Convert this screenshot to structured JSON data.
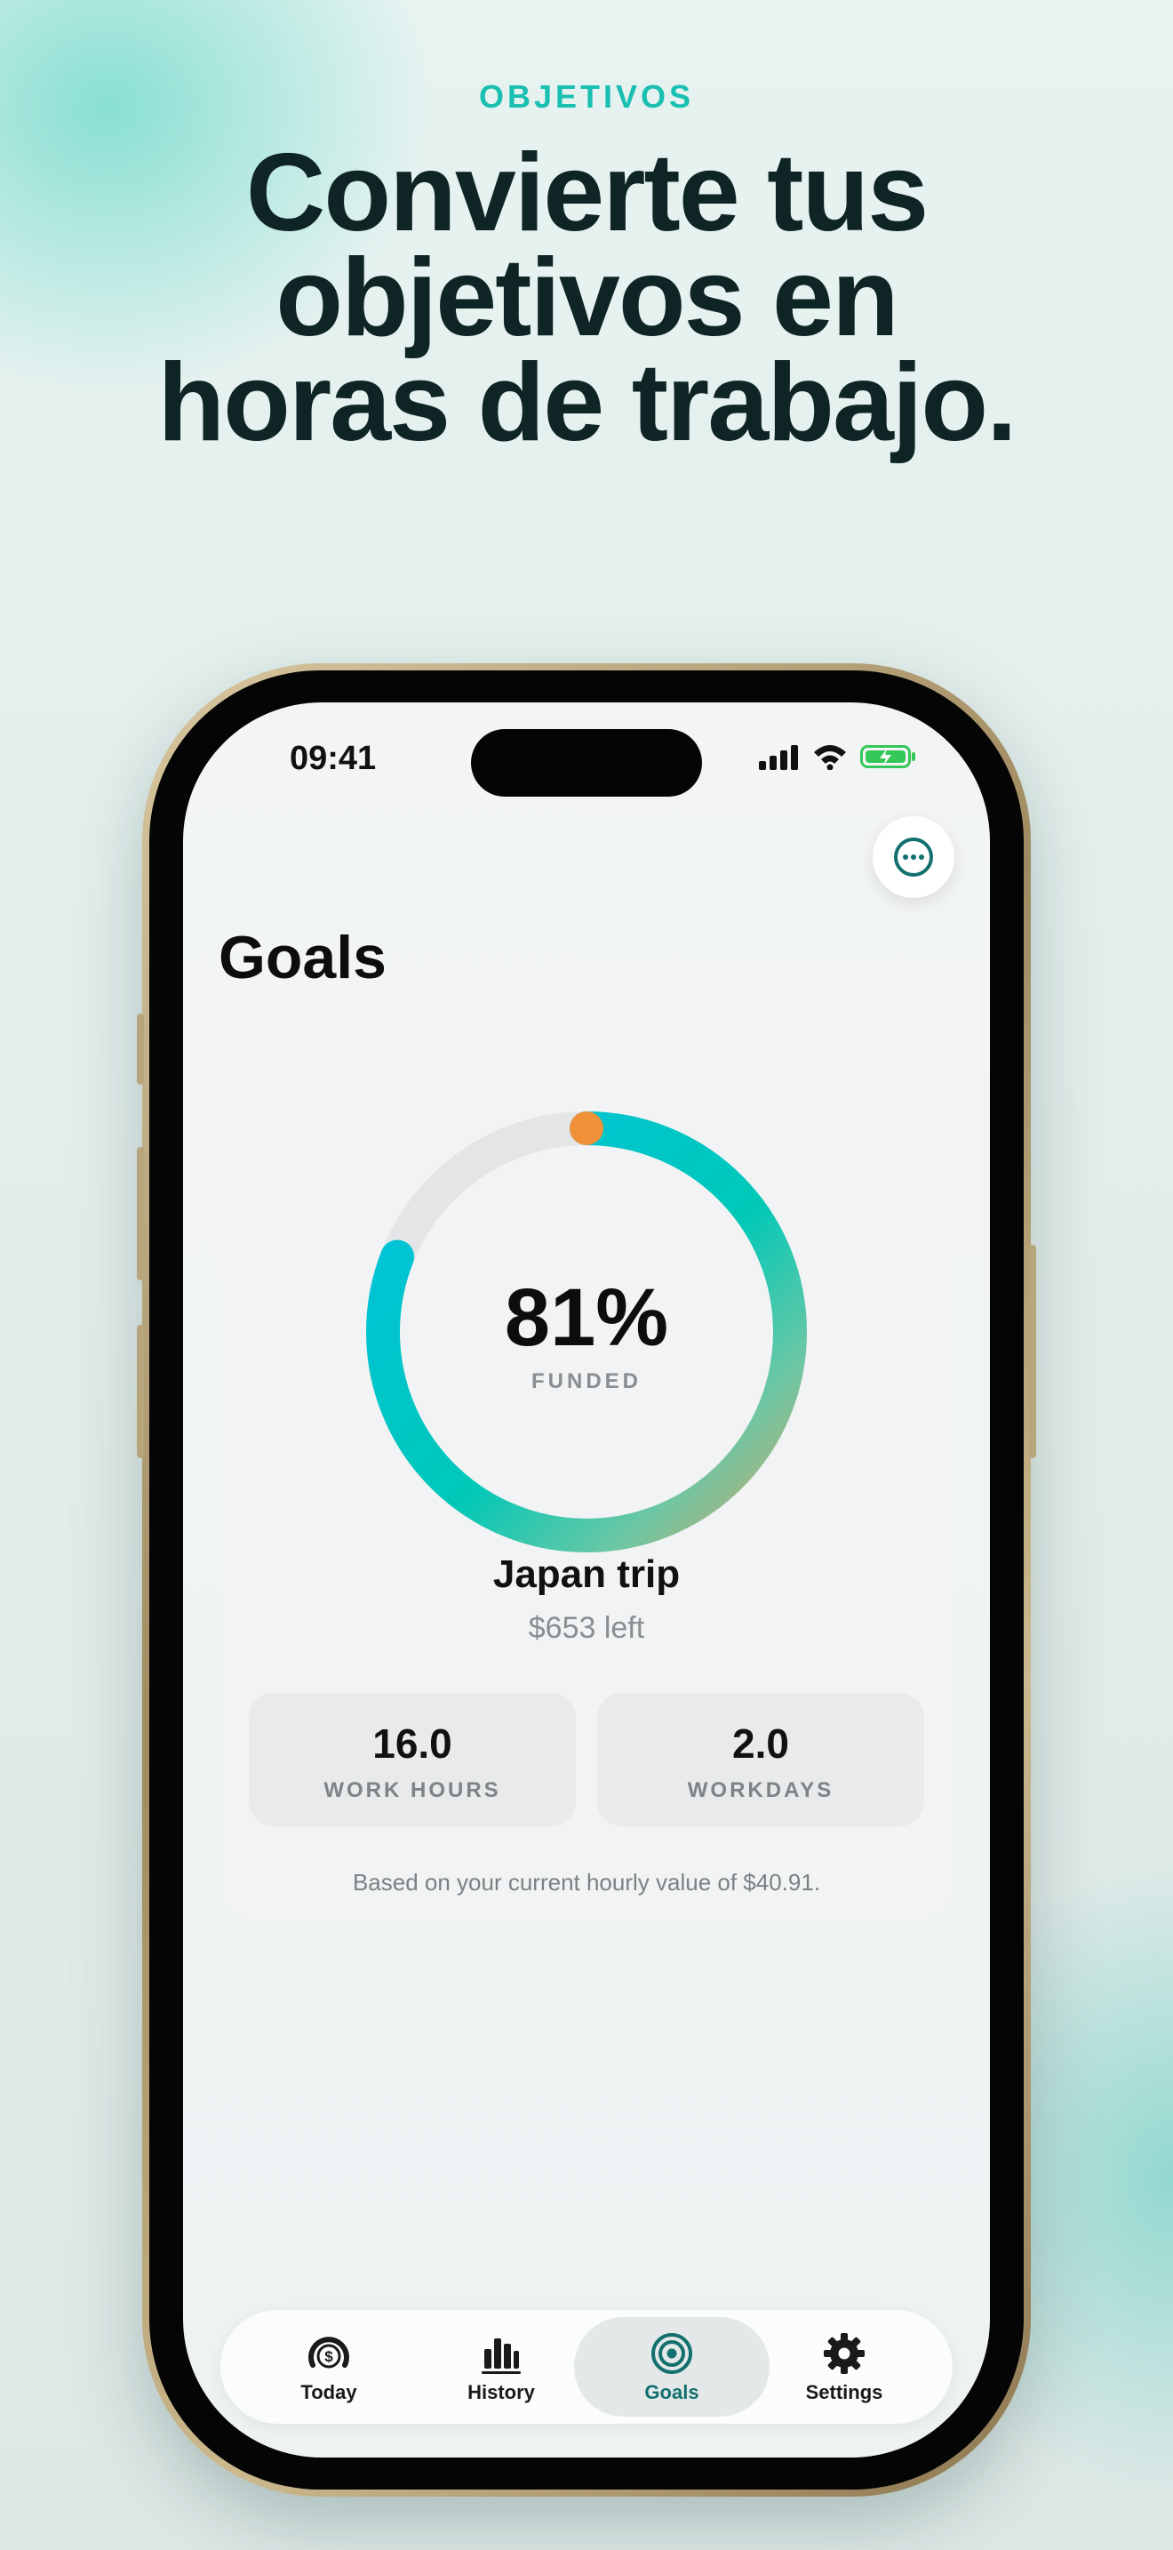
{
  "marketing": {
    "eyebrow": "OBJETIVOS",
    "headline": "Convierte tus objetivos en horas de trabajo."
  },
  "status_bar": {
    "time": "09:41"
  },
  "page": {
    "title": "Goals"
  },
  "goal": {
    "percent_text": "81%",
    "funded_label": "FUNDED",
    "funded_fraction": 0.81,
    "name": "Japan trip",
    "left_text": "$653 left",
    "stats": [
      {
        "value": "16.0",
        "label": "WORK HOURS"
      },
      {
        "value": "2.0",
        "label": "WORKDAYS"
      }
    ],
    "footnote": "Based on your current hourly value of $40.91."
  },
  "tabbar": {
    "tabs": [
      {
        "label": "Today",
        "icon": "dollar-gauge-icon",
        "active": false
      },
      {
        "label": "History",
        "icon": "bar-chart-icon",
        "active": false
      },
      {
        "label": "Goals",
        "icon": "target-icon",
        "active": true
      },
      {
        "label": "Settings",
        "icon": "gear-icon",
        "active": false
      }
    ]
  },
  "colors": {
    "accent": "#19bfb0",
    "ring_start": "#00c2e0",
    "ring_end": "#c8a86a",
    "ring_marker": "#f0913a",
    "active_tab": "#12706f"
  }
}
